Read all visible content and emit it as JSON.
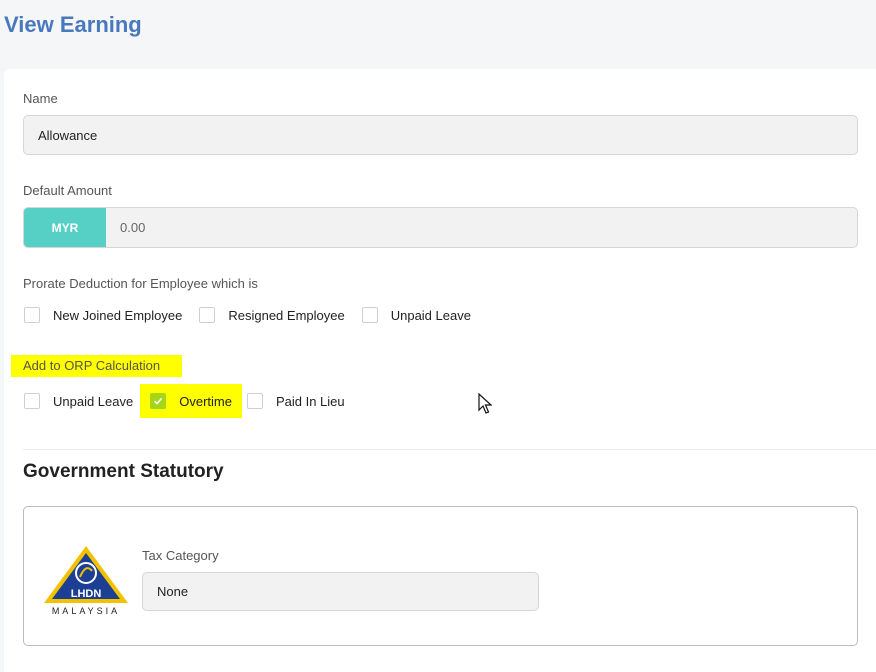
{
  "page": {
    "title": "View Earning"
  },
  "form": {
    "name": {
      "label": "Name",
      "value": "Allowance"
    },
    "default_amount": {
      "label": "Default Amount",
      "currency": "MYR",
      "value": "0.00"
    },
    "prorate": {
      "label": "Prorate Deduction for Employee which is",
      "options": [
        {
          "label": "New Joined Employee",
          "checked": false
        },
        {
          "label": "Resigned Employee",
          "checked": false
        },
        {
          "label": "Unpaid Leave",
          "checked": false
        }
      ]
    },
    "orp": {
      "label": "Add to ORP Calculation",
      "options": [
        {
          "label": "Unpaid Leave",
          "checked": false
        },
        {
          "label": "Overtime",
          "checked": true
        },
        {
          "label": "Paid In Lieu",
          "checked": false
        }
      ]
    }
  },
  "statutory": {
    "title": "Government Statutory",
    "logo_text": "LHDN",
    "logo_caption": "MALAYSIA",
    "tax_category": {
      "label": "Tax Category",
      "value": "None"
    }
  },
  "colors": {
    "title": "#4a78bd",
    "currency_addon": "#56cfc5",
    "highlight": "#ffff00",
    "checkbox_checked": "#a6d61a"
  },
  "icons": {
    "checkmark": "check-icon",
    "cursor": "mouse-pointer-icon",
    "logo": "lhdn-logo"
  }
}
